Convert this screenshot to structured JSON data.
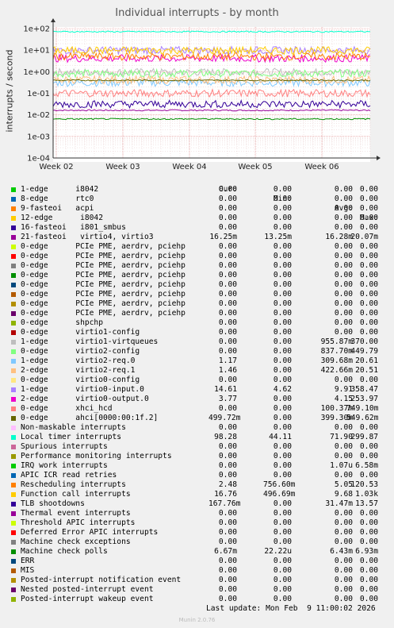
{
  "chart_data": {
    "type": "line",
    "title": "Individual interrupts - by month",
    "ylabel": "interrupts / second",
    "yscale": "log",
    "ylim": [
      0.0001,
      100
    ],
    "ytick_labels": [
      "1e+02",
      "1e+01",
      "1e+00",
      "1e-01",
      "1e-02",
      "1e-03",
      "1e-04"
    ],
    "xtick_labels": [
      "Week 02",
      "Week 03",
      "Week 04",
      "Week 05",
      "Week 06"
    ],
    "grid": true,
    "legend_position": "bottom",
    "columns": [
      "Cur:",
      "Min:",
      "Avg:",
      "Max:"
    ],
    "series": [
      {
        "name": "1-edge      i8042",
        "color": "#00cc00",
        "cur": "0.00",
        "min": "0.00",
        "avg": "0.00",
        "max": "0.00"
      },
      {
        "name": "8-edge      rtc0",
        "color": "#0066b3",
        "cur": "0.00",
        "min": "0.00",
        "avg": "0.00",
        "max": "0.00"
      },
      {
        "name": "9-fasteoi   acpi",
        "color": "#ff8000",
        "cur": "0.00",
        "min": "0.00",
        "avg": "0.00",
        "max": "0.00"
      },
      {
        "name": "12-edge      i8042",
        "color": "#ffcc00",
        "cur": "0.00",
        "min": "0.00",
        "avg": "0.00",
        "max": "0.00"
      },
      {
        "name": "16-fasteoi   i801_smbus",
        "color": "#330099",
        "cur": "0.00",
        "min": "0.00",
        "avg": "0.00",
        "max": "0.00"
      },
      {
        "name": "21-fasteoi   virtio4, virtio3",
        "color": "#990099",
        "cur": "16.25m",
        "min": "13.25m",
        "avg": "16.28m",
        "max": "20.07m"
      },
      {
        "name": "0-edge      PCIe PME, aerdrv, pciehp",
        "color": "#ccff00",
        "cur": "0.00",
        "min": "0.00",
        "avg": "0.00",
        "max": "0.00"
      },
      {
        "name": "0-edge      PCIe PME, aerdrv, pciehp",
        "color": "#ff0000",
        "cur": "0.00",
        "min": "0.00",
        "avg": "0.00",
        "max": "0.00"
      },
      {
        "name": "0-edge      PCIe PME, aerdrv, pciehp",
        "color": "#808080",
        "cur": "0.00",
        "min": "0.00",
        "avg": "0.00",
        "max": "0.00"
      },
      {
        "name": "0-edge      PCIe PME, aerdrv, pciehp",
        "color": "#008f00",
        "cur": "0.00",
        "min": "0.00",
        "avg": "0.00",
        "max": "0.00"
      },
      {
        "name": "0-edge      PCIe PME, aerdrv, pciehp",
        "color": "#00487d",
        "cur": "0.00",
        "min": "0.00",
        "avg": "0.00",
        "max": "0.00"
      },
      {
        "name": "0-edge      PCIe PME, aerdrv, pciehp",
        "color": "#b35a00",
        "cur": "0.00",
        "min": "0.00",
        "avg": "0.00",
        "max": "0.00"
      },
      {
        "name": "0-edge      PCIe PME, aerdrv, pciehp",
        "color": "#b38f00",
        "cur": "0.00",
        "min": "0.00",
        "avg": "0.00",
        "max": "0.00"
      },
      {
        "name": "0-edge      PCIe PME, aerdrv, pciehp",
        "color": "#6b006b",
        "cur": "0.00",
        "min": "0.00",
        "avg": "0.00",
        "max": "0.00"
      },
      {
        "name": "0-edge      shpchp",
        "color": "#8fb300",
        "cur": "0.00",
        "min": "0.00",
        "avg": "0.00",
        "max": "0.00"
      },
      {
        "name": "0-edge      virtio1-config",
        "color": "#b30000",
        "cur": "0.00",
        "min": "0.00",
        "avg": "0.00",
        "max": "0.00"
      },
      {
        "name": "1-edge      virtio1-virtqueues",
        "color": "#bebebe",
        "cur": "0.00",
        "min": "0.00",
        "avg": "955.87m",
        "max": "370.00"
      },
      {
        "name": "0-edge      virtio2-config",
        "color": "#80ff80",
        "cur": "0.00",
        "min": "0.00",
        "avg": "837.70m",
        "max": "449.79"
      },
      {
        "name": "1-edge      virtio2-req.0",
        "color": "#80c9ff",
        "cur": "1.17",
        "min": "0.00",
        "avg": "309.68m",
        "max": "20.61"
      },
      {
        "name": "2-edge      virtio2-req.1",
        "color": "#ffc080",
        "cur": "1.46",
        "min": "0.00",
        "avg": "422.66m",
        "max": "20.51"
      },
      {
        "name": "0-edge      virtio0-config",
        "color": "#ffe680",
        "cur": "0.00",
        "min": "0.00",
        "avg": "0.00",
        "max": "0.00"
      },
      {
        "name": "1-edge      virtio0-input.0",
        "color": "#aa80ff",
        "cur": "14.61",
        "min": "4.62",
        "avg": "9.91",
        "max": "358.47"
      },
      {
        "name": "2-edge      virtio0-output.0",
        "color": "#ee00cc",
        "cur": "3.77",
        "min": "0.00",
        "avg": "4.15",
        "max": "253.97"
      },
      {
        "name": "0-edge      xhci_hcd",
        "color": "#ff8080",
        "cur": "0.00",
        "min": "0.00",
        "avg": "100.37m",
        "max": "749.10m"
      },
      {
        "name": "0-edge      ahci[0000:00:1f.2]",
        "color": "#666600",
        "cur": "499.72m",
        "min": "0.00",
        "avg": "399.30m",
        "max": "549.62m"
      },
      {
        "name": "Non-maskable interrupts",
        "color": "#ffbfff",
        "cur": "0.00",
        "min": "0.00",
        "avg": "0.00",
        "max": "0.00"
      },
      {
        "name": "Local timer interrupts",
        "color": "#00ffcc",
        "cur": "98.28",
        "min": "44.11",
        "avg": "71.90",
        "max": "299.87"
      },
      {
        "name": "Spurious interrupts",
        "color": "#cc6699",
        "cur": "0.00",
        "min": "0.00",
        "avg": "0.00",
        "max": "0.00"
      },
      {
        "name": "Performance monitoring interrupts",
        "color": "#999900",
        "cur": "0.00",
        "min": "0.00",
        "avg": "0.00",
        "max": "0.00"
      },
      {
        "name": "IRQ work interrupts",
        "color": "#00cc00",
        "cur": "0.00",
        "min": "0.00",
        "avg": "1.07u",
        "max": "6.58m"
      },
      {
        "name": "APIC ICR read retries",
        "color": "#0066b3",
        "cur": "0.00",
        "min": "0.00",
        "avg": "0.00",
        "max": "0.00"
      },
      {
        "name": "Rescheduling interrupts",
        "color": "#ff8000",
        "cur": "2.48",
        "min": "756.60m",
        "avg": "5.05",
        "max": "120.53"
      },
      {
        "name": "Function call interrupts",
        "color": "#ffcc00",
        "cur": "16.76",
        "min": "496.69m",
        "avg": "9.68",
        "max": "1.03k"
      },
      {
        "name": "TLB shootdowns",
        "color": "#330099",
        "cur": "167.76m",
        "min": "0.00",
        "avg": "31.47m",
        "max": "13.57"
      },
      {
        "name": "Thermal event interrupts",
        "color": "#990099",
        "cur": "0.00",
        "min": "0.00",
        "avg": "0.00",
        "max": "0.00"
      },
      {
        "name": "Threshold APIC interrupts",
        "color": "#ccff00",
        "cur": "0.00",
        "min": "0.00",
        "avg": "0.00",
        "max": "0.00"
      },
      {
        "name": "Deferred Error APIC interrupts",
        "color": "#ff0000",
        "cur": "0.00",
        "min": "0.00",
        "avg": "0.00",
        "max": "0.00"
      },
      {
        "name": "Machine check exceptions",
        "color": "#808080",
        "cur": "0.00",
        "min": "0.00",
        "avg": "0.00",
        "max": "0.00"
      },
      {
        "name": "Machine check polls",
        "color": "#008f00",
        "cur": "6.67m",
        "min": "22.22u",
        "avg": "6.43m",
        "max": "6.93m"
      },
      {
        "name": "ERR",
        "color": "#00487d",
        "cur": "0.00",
        "min": "0.00",
        "avg": "0.00",
        "max": "0.00"
      },
      {
        "name": "MIS",
        "color": "#b35a00",
        "cur": "0.00",
        "min": "0.00",
        "avg": "0.00",
        "max": "0.00"
      },
      {
        "name": "Posted-interrupt notification event",
        "color": "#b38f00",
        "cur": "0.00",
        "min": "0.00",
        "avg": "0.00",
        "max": "0.00"
      },
      {
        "name": "Nested posted-interrupt event",
        "color": "#6b006b",
        "cur": "0.00",
        "min": "0.00",
        "avg": "0.00",
        "max": "0.00"
      },
      {
        "name": "Posted-interrupt wakeup event",
        "color": "#8fb300",
        "cur": "0.00",
        "min": "0.00",
        "avg": "0.00",
        "max": "0.00"
      }
    ]
  },
  "watermark": "RRDTOOL / TOBI OETIKER",
  "last_update": "Last update: Mon Feb  9 11:00:02 2026",
  "version": "Munin 2.0.76"
}
